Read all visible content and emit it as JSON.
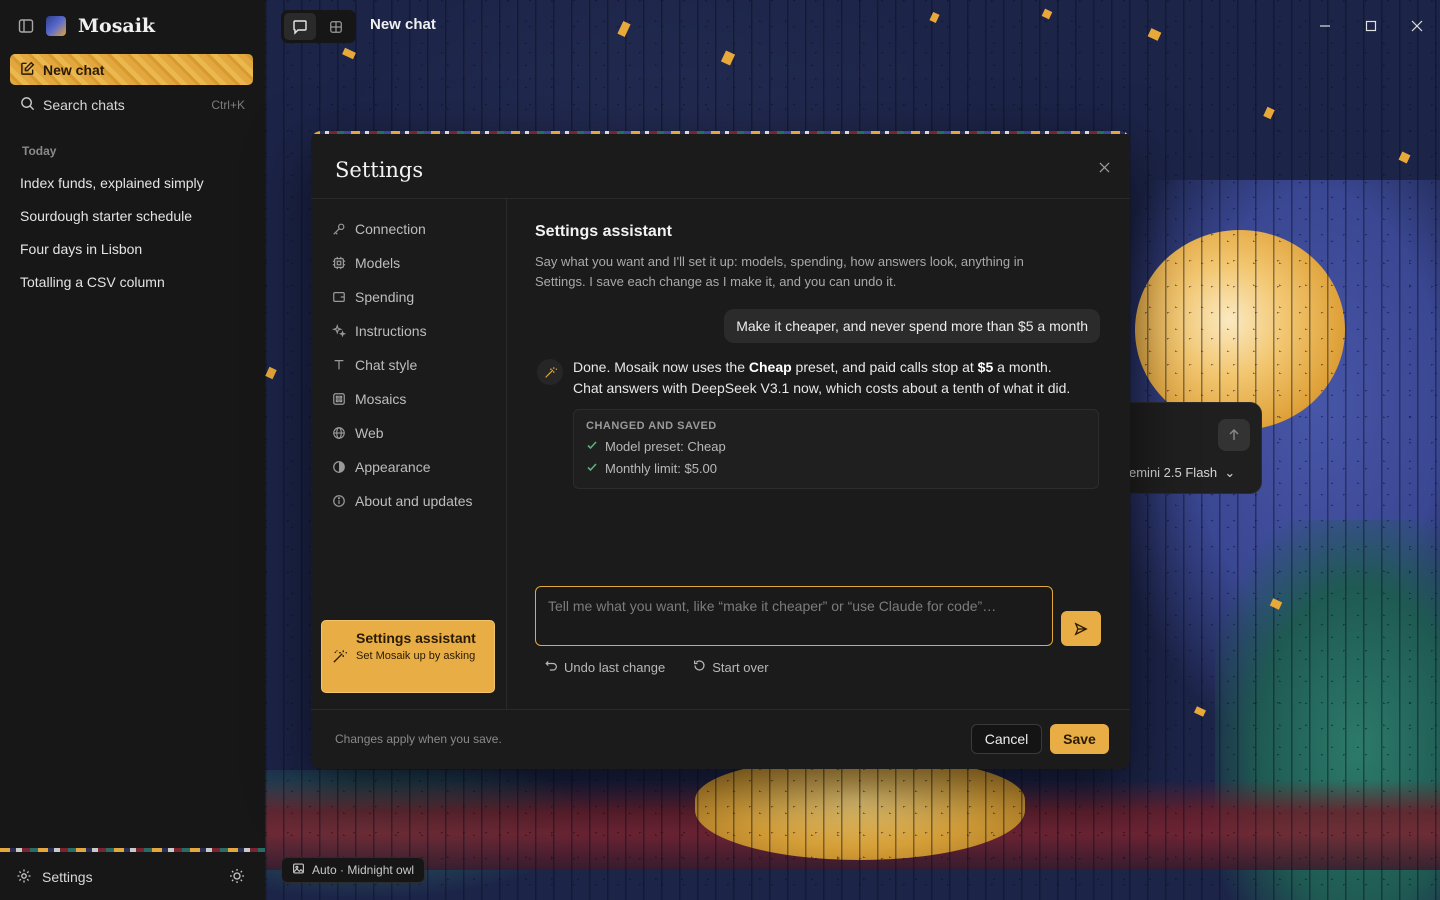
{
  "app": {
    "name": "Mosaik",
    "page_title": "New chat"
  },
  "sidebar": {
    "new_chat_label": "New chat",
    "search_label": "Search chats",
    "search_shortcut": "Ctrl+K",
    "section_today": "Today",
    "chats": [
      "Index funds, explained simply",
      "Sourdough starter schedule",
      "Four days in Lisbon",
      "Totalling a CSV column"
    ],
    "settings_label": "Settings"
  },
  "composer_behind": {
    "model_label": "emini 2.5 Flash"
  },
  "wallpaper_chip": "Auto · Midnight owl",
  "settings": {
    "title": "Settings",
    "nav": [
      {
        "label": "Connection",
        "icon": "key-icon"
      },
      {
        "label": "Models",
        "icon": "chip-icon"
      },
      {
        "label": "Spending",
        "icon": "wallet-icon"
      },
      {
        "label": "Instructions",
        "icon": "sparkles-icon"
      },
      {
        "label": "Chat style",
        "icon": "type-icon"
      },
      {
        "label": "Mosaics",
        "icon": "grid-icon"
      },
      {
        "label": "Web",
        "icon": "globe-icon"
      },
      {
        "label": "Appearance",
        "icon": "contrast-icon"
      },
      {
        "label": "About and updates",
        "icon": "info-icon"
      }
    ],
    "assistant_card": {
      "title": "Settings assistant",
      "subtitle": "Set Mosaik up by asking"
    },
    "pane": {
      "title": "Settings assistant",
      "description": "Say what you want and I'll set it up: models, spending, how answers look, anything in Settings. I save each change as I make it, and you can undo it.",
      "user_message": "Make it cheaper, and never spend more than $5 a month",
      "reply": {
        "p1_pre": "Done. Mosaik now uses the ",
        "p1_bold1": "Cheap",
        "p1_mid": " preset, and paid calls stop at ",
        "p1_bold2": "$5",
        "p1_post": " a month.",
        "p2": "Chat answers with DeepSeek V3.1 now, which costs about a tenth of what it did."
      },
      "changes_header": "CHANGED AND SAVED",
      "changes": [
        "Model preset: Cheap",
        "Monthly limit: $5.00"
      ],
      "input_placeholder": "Tell me what you want, like “make it cheaper” or “use Claude for code”…",
      "undo_label": "Undo last change",
      "start_over_label": "Start over"
    },
    "footer_note": "Changes apply when you save.",
    "cancel_label": "Cancel",
    "save_label": "Save"
  },
  "colors": {
    "accent": "#e8ae45",
    "sidebar_bg": "#171717",
    "modal_bg": "#1b1b1b",
    "check_green": "#5fae7a"
  }
}
